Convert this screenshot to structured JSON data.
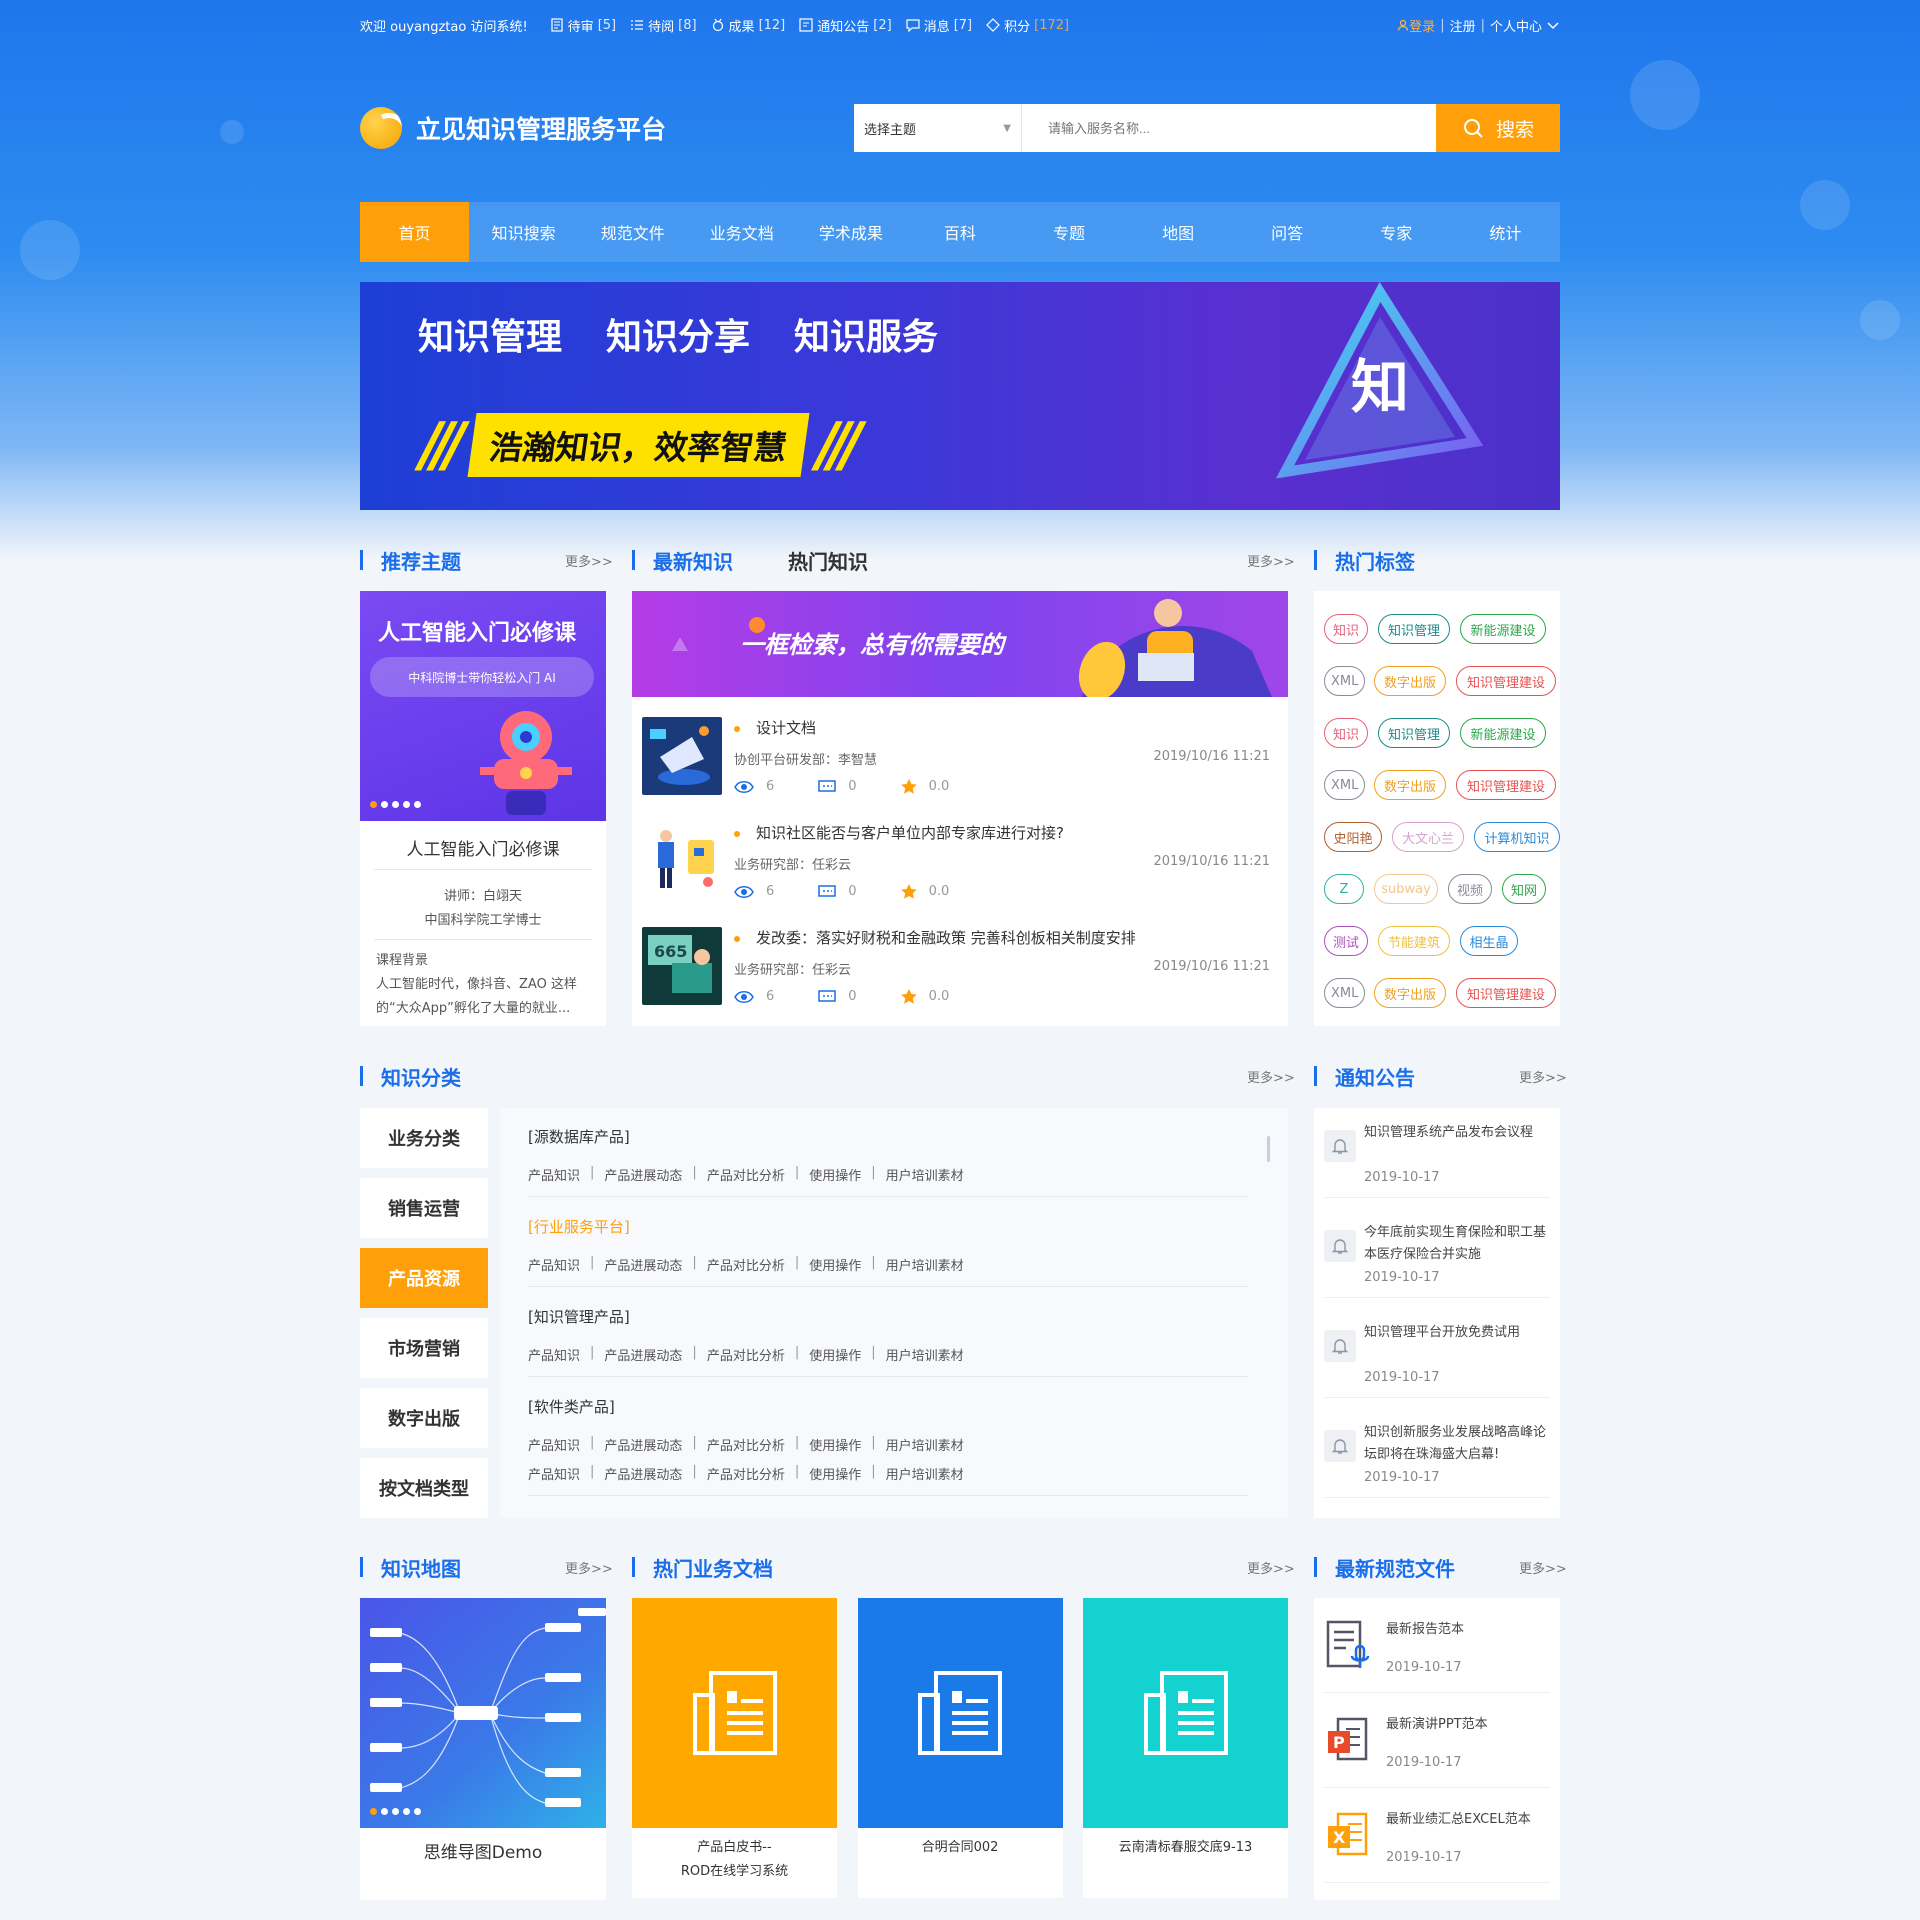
{
  "topbar": {
    "welcome": "欢迎 ouyangztao 访问系统!",
    "items": [
      {
        "label": "待审",
        "count": "[5]",
        "icon": "review-icon"
      },
      {
        "label": "待阅",
        "count": "[8]",
        "icon": "list-icon"
      },
      {
        "label": "成果",
        "count": "[12]",
        "icon": "medal-icon"
      },
      {
        "label": "通知公告",
        "count": "[2]",
        "icon": "notice-icon"
      },
      {
        "label": "消息",
        "count": "[7]",
        "icon": "message-icon"
      },
      {
        "label": "积分",
        "count": "[172]",
        "icon": "diamond-icon"
      }
    ],
    "login": "登录",
    "register": "注册",
    "personal": "个人中心"
  },
  "header": {
    "title": "立见知识管理服务平台",
    "select_label": "选择主题",
    "search_placeholder": "请输入服务名称...",
    "search_button": "搜索"
  },
  "nav": [
    "首页",
    "知识搜索",
    "规范文件",
    "业务文档",
    "学术成果",
    "百科",
    "专题",
    "地图",
    "问答",
    "专家",
    "统计"
  ],
  "banner": {
    "headings": [
      "知识管理",
      "知识分享",
      "知识服务"
    ],
    "slogan": "浩瀚知识，效率智慧",
    "slash": "///",
    "badge": "知"
  },
  "more_label": "更多>>",
  "recommend": {
    "title": "推荐主题",
    "image_title": "人工智能入门必修课",
    "image_sub": "中科院博士带你轻松入门 AI",
    "caption": "人工智能入门必修课",
    "lecturer": "讲师：白翊天",
    "lecturer_title": "中国科学院工学博士",
    "bg_label": "课程背景",
    "bg_text": "人工智能时代，像抖音、ZAO 这样的“大众App”孵化了大量的就业..."
  },
  "knowledge": {
    "tab_latest": "最新知识",
    "tab_hot": "热门知识",
    "banner_text": "一框检索，总有你需要的",
    "items": [
      {
        "title": "设计文档",
        "dept": "协创平台研发部：李智慧",
        "date": "2019/10/16 11:21",
        "views": "6",
        "comments": "0",
        "score": "0.0"
      },
      {
        "title": "知识社区能否与客户单位内部专家库进行对接?",
        "dept": "业务研究部：任彩云",
        "date": "2019/10/16 11:21",
        "views": "6",
        "comments": "0",
        "score": "0.0"
      },
      {
        "title": "发改委：落实好财税和金融政策 完善科创板相关制度安排",
        "dept": "业务研究部：任彩云",
        "date": "2019/10/16 11:21",
        "views": "6",
        "comments": "0",
        "score": "0.0"
      }
    ]
  },
  "tags": {
    "title": "热门标签",
    "rows": [
      [
        {
          "t": "知识",
          "c": "#e8607a"
        },
        {
          "t": "知识管理",
          "c": "#1a8a8a"
        },
        {
          "t": "新能源建设",
          "c": "#2aa84a"
        }
      ],
      [
        {
          "t": "XML",
          "c": "#8a8a9a"
        },
        {
          "t": "数字出版",
          "c": "#f0a020"
        },
        {
          "t": "知识管理建设",
          "c": "#e85050"
        }
      ],
      [
        {
          "t": "知识",
          "c": "#e8607a"
        },
        {
          "t": "知识管理",
          "c": "#1a8a8a"
        },
        {
          "t": "新能源建设",
          "c": "#2aa84a"
        }
      ],
      [
        {
          "t": "XML",
          "c": "#8a8a9a"
        },
        {
          "t": "数字出版",
          "c": "#f0a020"
        },
        {
          "t": "知识管理建设",
          "c": "#e85050"
        }
      ],
      [
        {
          "t": "史阳艳",
          "c": "#b06030"
        },
        {
          "t": "大文心兰",
          "c": "#d8a0d0"
        },
        {
          "t": "计算机知识",
          "c": "#2a8ad8"
        }
      ],
      [
        {
          "t": "Z",
          "c": "#30b0a0"
        },
        {
          "t": "subway",
          "c": "#f0c890"
        },
        {
          "t": "视频",
          "c": "#8a8a9a"
        },
        {
          "t": "知网",
          "c": "#2aa84a"
        }
      ],
      [
        {
          "t": "测试",
          "c": "#b050c0"
        },
        {
          "t": "节能建筑",
          "c": "#f0c040"
        },
        {
          "t": "相生晶",
          "c": "#2a8ad8"
        }
      ],
      [
        {
          "t": "XML",
          "c": "#8a8a9a"
        },
        {
          "t": "数字出版",
          "c": "#f0a020"
        },
        {
          "t": "知识管理建设",
          "c": "#e85050"
        }
      ]
    ]
  },
  "category": {
    "title": "知识分类",
    "left": [
      "业务分类",
      "销售运营",
      "产品资源",
      "市场营销",
      "数字出版",
      "按文档类型"
    ],
    "active": 2,
    "groups": [
      {
        "title": "[源数据库产品]",
        "links": [
          [
            "产品知识",
            "产品进展动态",
            "产品对比分析",
            "使用操作",
            "用户培训素材"
          ]
        ]
      },
      {
        "title": "[行业服务平台]",
        "links": [
          [
            "产品知识",
            "产品进展动态",
            "产品对比分析",
            "使用操作",
            "用户培训素材"
          ]
        ]
      },
      {
        "title": "[知识管理产品]",
        "links": [
          [
            "产品知识",
            "产品进展动态",
            "产品对比分析",
            "使用操作",
            "用户培训素材"
          ]
        ]
      },
      {
        "title": "[软件类产品]",
        "links": [
          [
            "产品知识",
            "产品进展动态",
            "产品对比分析",
            "使用操作",
            "用户培训素材"
          ],
          [
            "产品知识",
            "产品进展动态",
            "产品对比分析",
            "使用操作",
            "用户培训素材"
          ]
        ]
      }
    ]
  },
  "notices": {
    "title": "通知公告",
    "items": [
      {
        "text": "知识管理系统产品发布会议程",
        "date": "2019-10-17"
      },
      {
        "text": "今年底前实现生育保险和职工基本医疗保险合并实施",
        "date": "2019-10-17"
      },
      {
        "text": "知识管理平台开放免费试用",
        "date": "2019-10-17"
      },
      {
        "text": "知识创新服务业发展战略高峰论坛即将在珠海盛大启幕!",
        "date": "2019-10-17"
      }
    ]
  },
  "kmap": {
    "title": "知识地图",
    "caption": "思维导图Demo"
  },
  "hotdocs": {
    "title": "热门业务文档",
    "items": [
      {
        "caption": "产品白皮书--\nROD在线学习系统",
        "color": "#ffa800"
      },
      {
        "caption": "合明合同002",
        "color": "#1a7ae8"
      },
      {
        "caption": "云南清标春服交底9-13",
        "color": "#14d2d0"
      }
    ]
  },
  "specs": {
    "title": "最新规范文件",
    "items": [
      {
        "text": "最新报告范本",
        "date": "2019-10-17",
        "icon": "report-icon"
      },
      {
        "text": "最新演讲PPT范本",
        "date": "2019-10-17",
        "icon": "ppt-icon"
      },
      {
        "text": "最新业绩汇总EXCEL范本",
        "date": "2019-10-17",
        "icon": "excel-icon"
      }
    ]
  }
}
